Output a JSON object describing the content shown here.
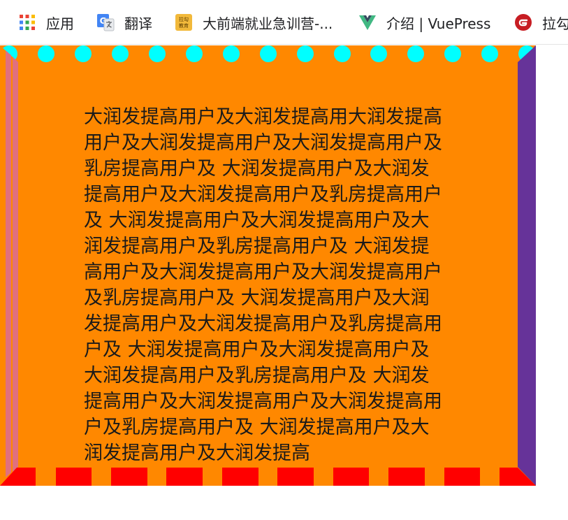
{
  "bookmarks": [
    {
      "label": "应用",
      "icon": "apps-grid-icon"
    },
    {
      "label": "翻译",
      "icon": "google-translate-icon"
    },
    {
      "label": "大前端就业急训营-...",
      "icon": "lagou-logo-icon",
      "icon_text": "拉勾\n教育"
    },
    {
      "label": "介绍 | VuePress",
      "icon": "vue-logo-icon"
    },
    {
      "label": "拉勾",
      "icon": "gitee-logo-icon"
    }
  ],
  "content": {
    "text": "大润发提高用户及大润发提高用大润发提高用户及大润发提高用户及大润发提高用户及乳房提高用户及 大润发提高用户及大润发提高用户及大润发提高用户及乳房提高用户及 大润发提高用户及大润发提高用户及大润发提高用户及乳房提高用户及 大润发提高用户及大润发提高用户及大润发提高用户及乳房提高用户及 大润发提高用户及大润发提高用户及大润发提高用户及乳房提高用户及 大润发提高用户及大润发提高用户及大润发提高用户及乳房提高用户及 大润发提高用户及大润发提高用户及大润发提高用户及乳房提高用户及 大润发提高用户及大润发提高用户及大润发提高"
  },
  "colors": {
    "background": "#ff8800",
    "top_dots": "#00ffff",
    "bottom_stripes": "#ff0000",
    "left_border": "#e07080",
    "right_border": "#663399"
  }
}
